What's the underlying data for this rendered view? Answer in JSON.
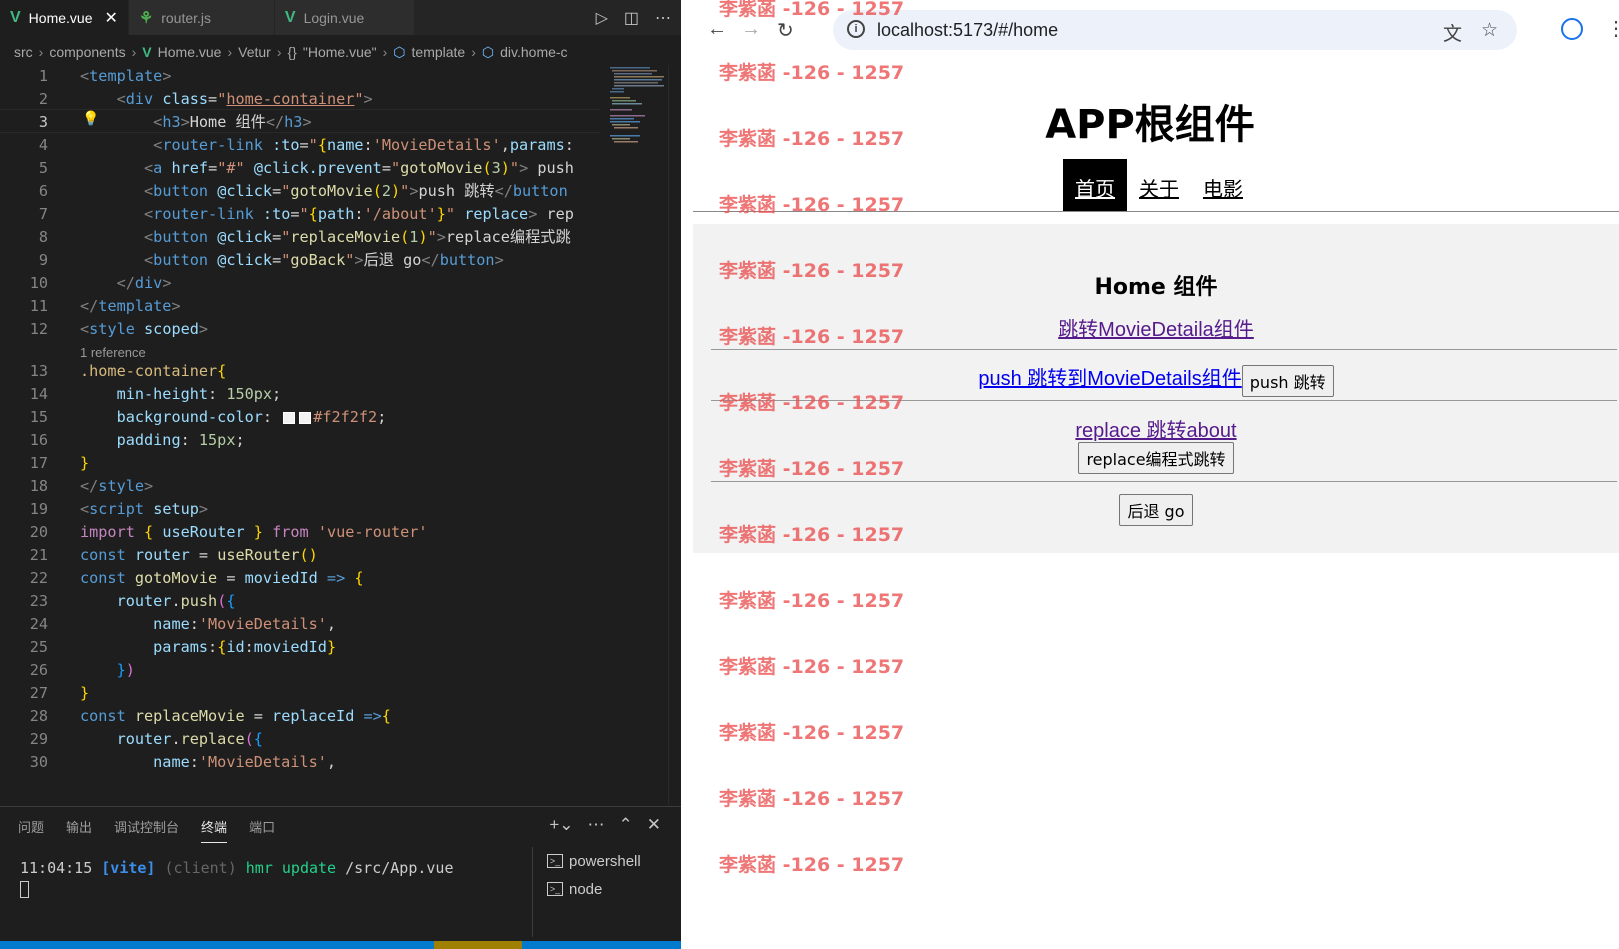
{
  "vscode": {
    "tabs": [
      {
        "label": "Home.vue",
        "icon": "vue-icon",
        "active": true,
        "close": "✕"
      },
      {
        "label": "router.js",
        "icon": "js-icon",
        "active": false
      },
      {
        "label": "Login.vue",
        "icon": "vue-icon",
        "active": false
      }
    ],
    "breadcrumb": [
      "src",
      "components",
      "Home.vue",
      "Vetur",
      "\"Home.vue\"",
      "template",
      "div.home-c"
    ],
    "line_numbers": [
      "1",
      "2",
      "3",
      "4",
      "5",
      "6",
      "7",
      "8",
      "9",
      "10",
      "11",
      "12",
      "13",
      "14",
      "15",
      "16",
      "17",
      "18",
      "19",
      "20",
      "21",
      "22",
      "23",
      "24",
      "25",
      "26",
      "27",
      "28",
      "29",
      "30"
    ],
    "codelens": "1 reference",
    "panel_tabs": [
      "问题",
      "输出",
      "调试控制台",
      "终端",
      "端口"
    ],
    "active_panel_tab": "终端",
    "terminal": {
      "time": "11:04:15",
      "vite": "[vite]",
      "client": "(client)",
      "msg": "hmr update",
      "path": "/src/App.vue"
    },
    "terminal_list": [
      "powershell",
      "node"
    ]
  },
  "browser": {
    "url": "localhost:5173/#/home",
    "app_title": "APP根组件",
    "nav": [
      "首页",
      "关于",
      "电影"
    ],
    "active_nav": "首页",
    "home_title": "Home 组件",
    "link1": "跳转MovieDetaila组件",
    "link2": "push 跳转到MovieDetails组件",
    "btn_push": "push 跳转",
    "link3": "replace 跳转about",
    "btn_replace": "replace编程式跳转",
    "btn_back": "后退 go",
    "watermark": "李紫菡 -126 - 1257",
    "colors": {
      "watermark": "#eb5050",
      "home_bg": "#f2f2f2",
      "nav_active_bg": "#000000"
    }
  }
}
